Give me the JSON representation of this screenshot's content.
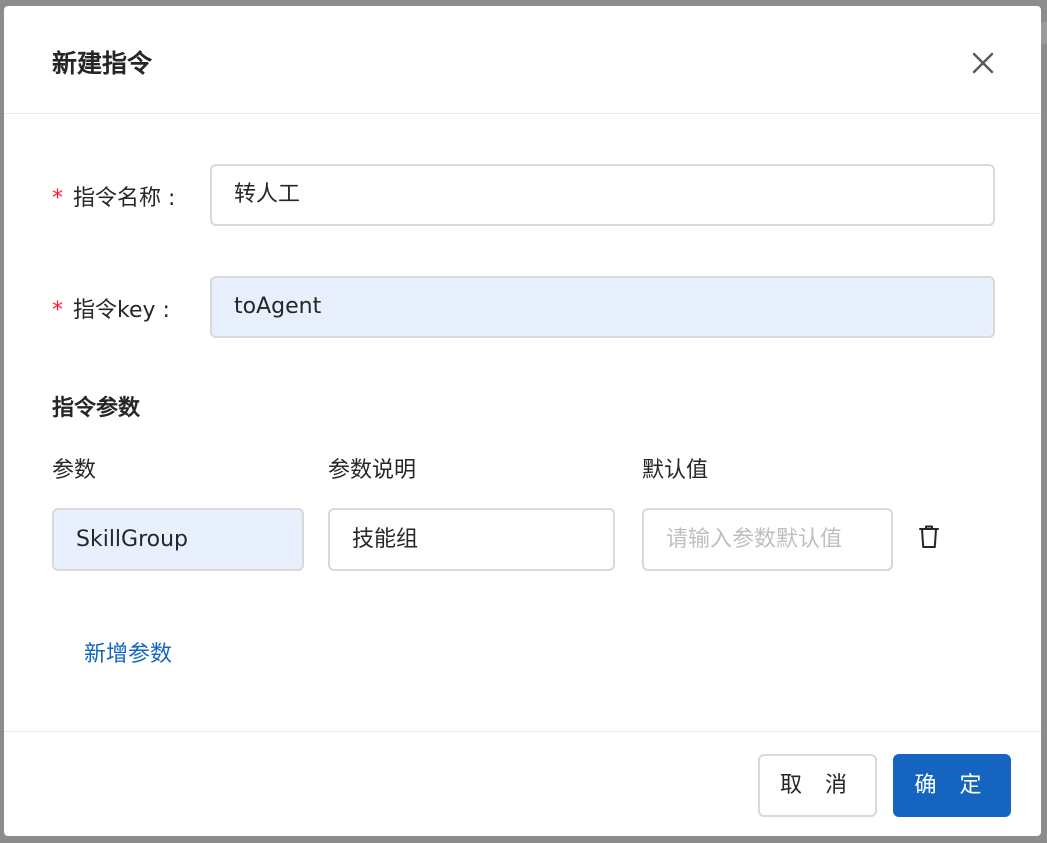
{
  "dialog": {
    "title": "新建指令",
    "close_icon": "close-icon"
  },
  "form": {
    "required_mark": "*",
    "name": {
      "label": "指令名称 :",
      "value": "转人工"
    },
    "key": {
      "label": "指令key :",
      "value": "toAgent"
    }
  },
  "params": {
    "section_title": "指令参数",
    "columns": {
      "param": "参数",
      "description": "参数说明",
      "default": "默认值"
    },
    "rows": [
      {
        "param": "SkillGroup",
        "description": "技能组",
        "default_placeholder": "请输入参数默认值",
        "delete_icon": "trash-icon"
      }
    ],
    "add_label": "新增参数"
  },
  "footer": {
    "cancel_label": "取 消",
    "ok_label": "确 定"
  },
  "colors": {
    "primary": "#1565c0",
    "required": "#f5222d",
    "autofill_bg": "#e8f0fe",
    "placeholder": "#bfbfbf"
  }
}
